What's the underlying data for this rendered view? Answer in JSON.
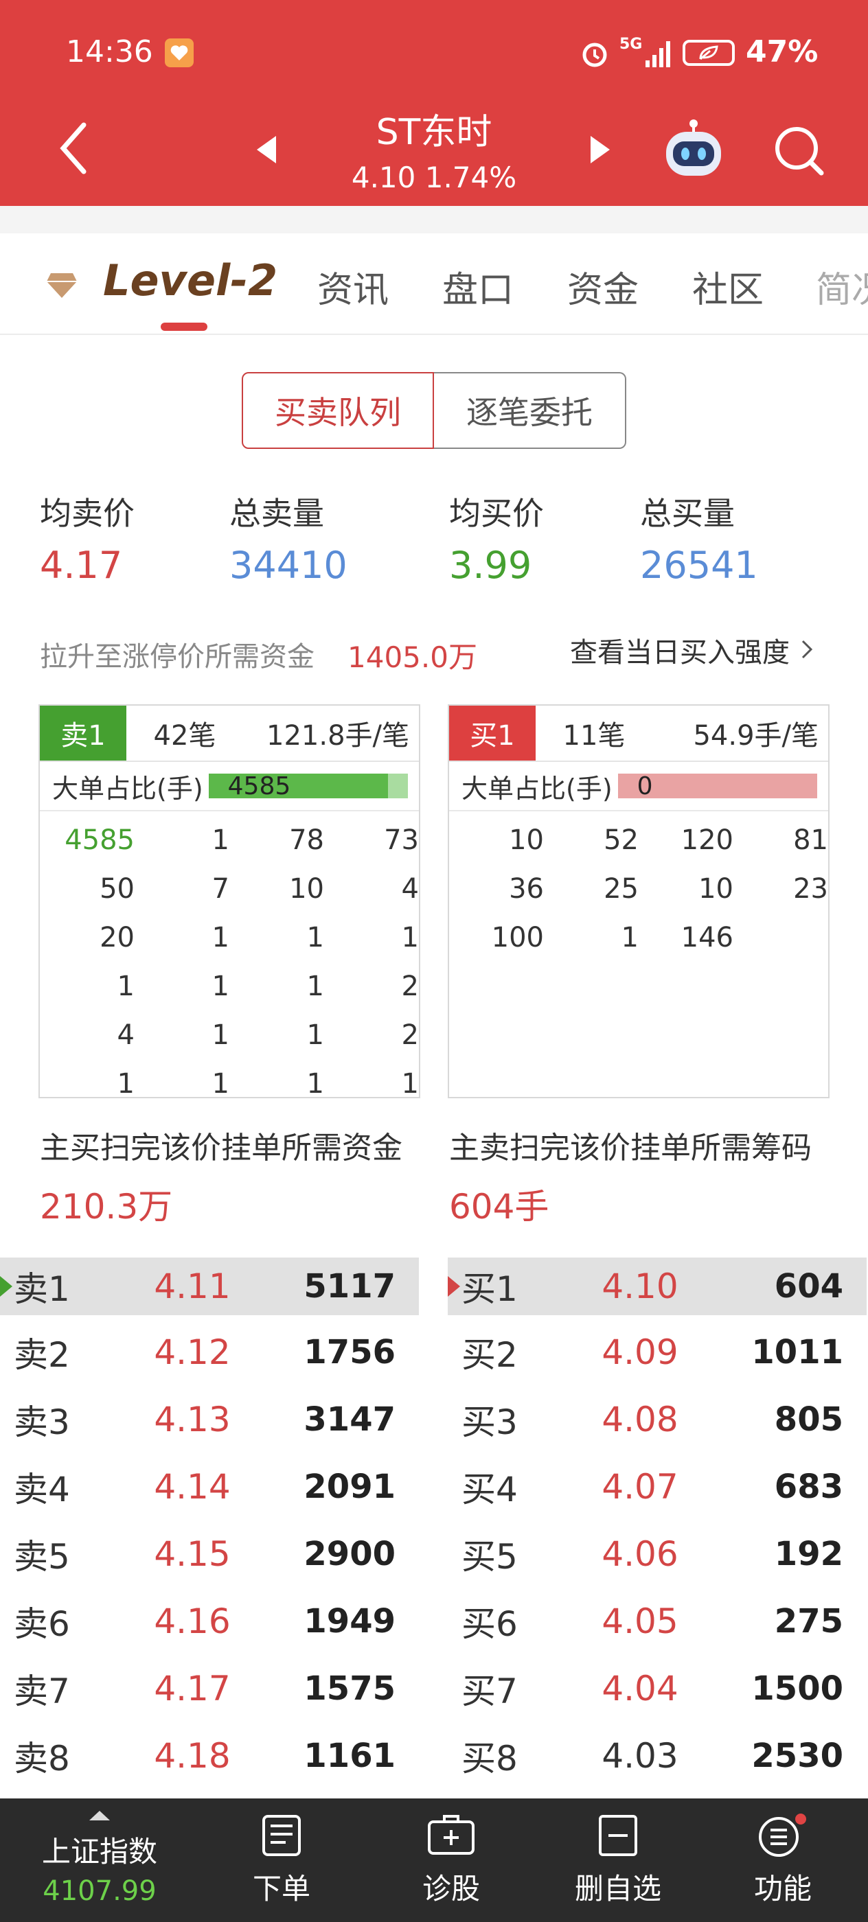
{
  "status_bar": {
    "time": "14:36",
    "network": "5G",
    "battery": "47%"
  },
  "header": {
    "title": "ST东时",
    "price": "4.10",
    "change": "1.74%"
  },
  "tabs": [
    "Level-2",
    "资讯",
    "盘口",
    "资金",
    "社区",
    "简况"
  ],
  "segment": {
    "active": "买卖队列",
    "inactive": "逐笔委托"
  },
  "stats": {
    "avg_sell_label": "均卖价",
    "avg_sell": "4.17",
    "total_sell_label": "总卖量",
    "total_sell": "34410",
    "avg_buy_label": "均买价",
    "avg_buy": "3.99",
    "total_buy_label": "总买量",
    "total_buy": "26541"
  },
  "limit_up": {
    "label": "拉升至涨停价所需资金",
    "value": "1405.0万",
    "link": "查看当日买入强度"
  },
  "sell_panel": {
    "badge": "卖1",
    "count": "42笔",
    "avg": "121.8手/笔",
    "big_label": "大单占比(手)",
    "big_value": "4585",
    "big_ratio": 0.9,
    "rows": [
      [
        "4585",
        "1",
        "78",
        "73"
      ],
      [
        "50",
        "7",
        "10",
        "4"
      ],
      [
        "20",
        "1",
        "1",
        "1"
      ],
      [
        "1",
        "1",
        "1",
        "2"
      ],
      [
        "4",
        "1",
        "1",
        "2"
      ],
      [
        "1",
        "1",
        "1",
        "1"
      ]
    ],
    "sweep_label": "主买扫完该价挂单所需资金",
    "sweep_value": "210.3万"
  },
  "buy_panel": {
    "badge": "买1",
    "count": "11笔",
    "avg": "54.9手/笔",
    "big_label": "大单占比(手)",
    "big_value": "0",
    "big_ratio": 0.0,
    "rows": [
      [
        "10",
        "52",
        "120",
        "81"
      ],
      [
        "36",
        "25",
        "10",
        "23"
      ],
      [
        "100",
        "1",
        "146",
        ""
      ]
    ],
    "sweep_label": "主卖扫完该价挂单所需筹码",
    "sweep_value": "604手"
  },
  "sell_book": [
    {
      "name": "卖1",
      "price": "4.11",
      "vol": "5117"
    },
    {
      "name": "卖2",
      "price": "4.12",
      "vol": "1756"
    },
    {
      "name": "卖3",
      "price": "4.13",
      "vol": "3147"
    },
    {
      "name": "卖4",
      "price": "4.14",
      "vol": "2091"
    },
    {
      "name": "卖5",
      "price": "4.15",
      "vol": "2900"
    },
    {
      "name": "卖6",
      "price": "4.16",
      "vol": "1949"
    },
    {
      "name": "卖7",
      "price": "4.17",
      "vol": "1575"
    },
    {
      "name": "卖8",
      "price": "4.18",
      "vol": "1161"
    }
  ],
  "buy_book": [
    {
      "name": "买1",
      "price": "4.10",
      "vol": "604"
    },
    {
      "name": "买2",
      "price": "4.09",
      "vol": "1011"
    },
    {
      "name": "买3",
      "price": "4.08",
      "vol": "805"
    },
    {
      "name": "买4",
      "price": "4.07",
      "vol": "683"
    },
    {
      "name": "买5",
      "price": "4.06",
      "vol": "192"
    },
    {
      "name": "买6",
      "price": "4.05",
      "vol": "275"
    },
    {
      "name": "买7",
      "price": "4.04",
      "vol": "1500"
    },
    {
      "name": "买8",
      "price": "4.03",
      "vol": "2530"
    }
  ],
  "bottom_nav": {
    "index_name": "上证指数",
    "index_value": "4107.99",
    "items": [
      "下单",
      "诊股",
      "删自选",
      "功能"
    ]
  },
  "colors": {
    "brand_red": "#dd4040",
    "sell_green": "#45a030",
    "buy_red": "#d34545",
    "nav_bg": "#2b2b2b"
  }
}
